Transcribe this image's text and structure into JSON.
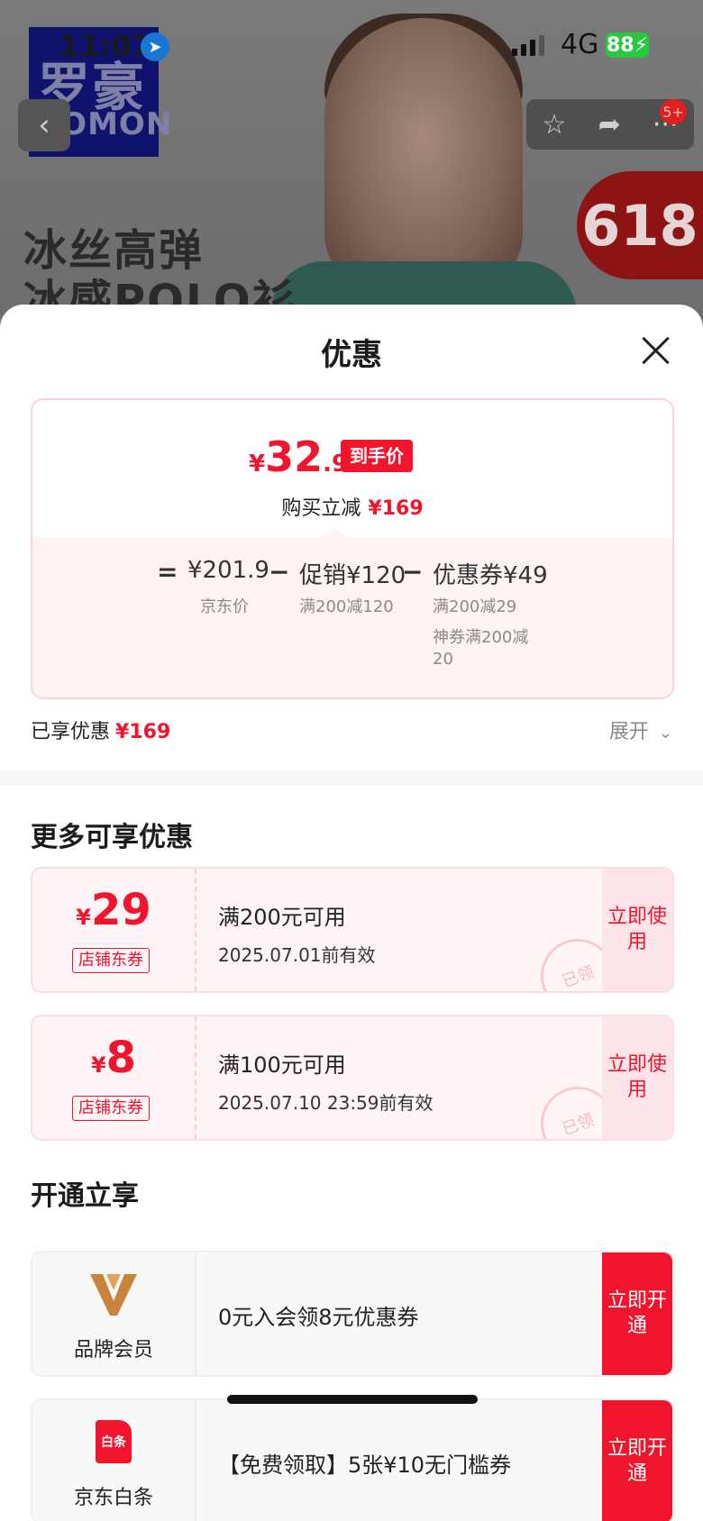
{
  "statusbar": {
    "time": "11:07",
    "network": "4G",
    "battery": "88"
  },
  "background": {
    "brand_cn": "罗豪",
    "brand_en": "ROMON",
    "promo_line1": "冰丝高弹",
    "promo_line2": "冰感POLO衫",
    "badge": "618",
    "cart_badge": "5+"
  },
  "sheet": {
    "title": "优惠",
    "final_price": {
      "yen": "¥",
      "int": "32",
      "dec": ".9",
      "tag": "到手价"
    },
    "saving": {
      "label": "购买立减",
      "amount": "¥169"
    },
    "calc": {
      "eq": "=",
      "jd_price": "¥201.9",
      "jd_price_label": "京东价",
      "minus1": "−",
      "promo": "促销¥120",
      "promo_rule": "满200减120",
      "minus2": "−",
      "coupon": "优惠券¥49",
      "coupon_rule1": "满200减29",
      "coupon_rule2": "神券满200减20"
    },
    "enjoyed": {
      "label": "已享优惠",
      "amount": "¥169"
    },
    "expand": "展开"
  },
  "more": {
    "title": "更多可享优惠",
    "coupons": [
      {
        "yen": "¥",
        "amount": "29",
        "type": "店铺东券",
        "condition": "满200元可用",
        "expiry": "2025.07.01前有效",
        "stamp": "已领",
        "button": "立即使用"
      },
      {
        "yen": "¥",
        "amount": "8",
        "type": "店铺东券",
        "condition": "满100元可用",
        "expiry": "2025.07.10 23:59前有效",
        "stamp": "已领",
        "button": "立即使用"
      }
    ]
  },
  "membership": {
    "title": "开通立享",
    "items": [
      {
        "name": "品牌会员",
        "desc": "0元入会领8元优惠券",
        "button": "立即开通"
      },
      {
        "name": "京东白条",
        "logo_text": "白条",
        "desc": "【免费领取】5张¥10无门槛券",
        "button": "立即开通"
      }
    ]
  },
  "colors": {
    "accent": "#f0142c",
    "coupon_bg": "#fff5f6"
  }
}
